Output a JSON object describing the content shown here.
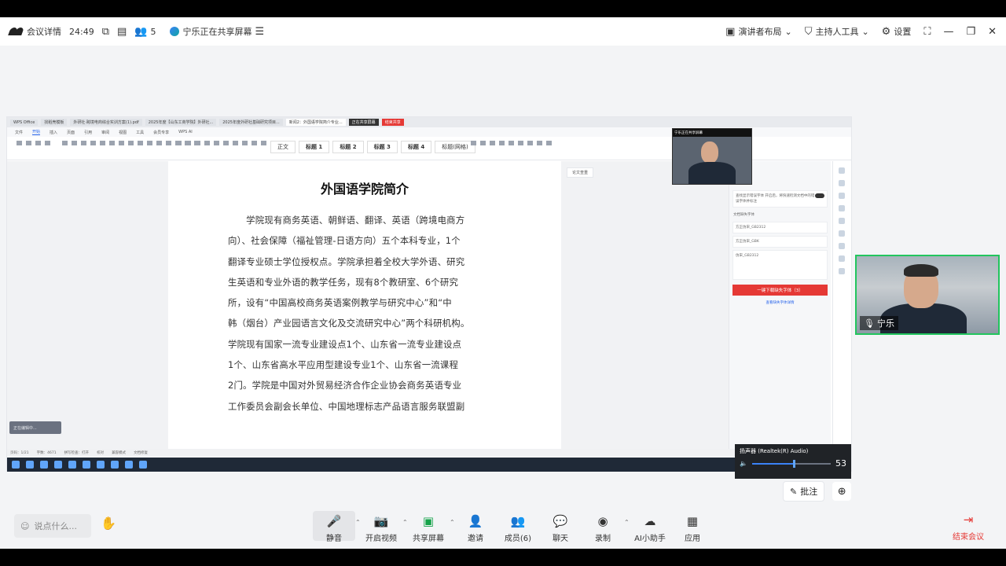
{
  "topbar": {
    "meeting_details": "会议详情",
    "timer": "24:49",
    "participants_count": "5",
    "sharing_text": "宁乐正在共享屏幕",
    "speaker_layout": "演讲者布局",
    "host_tools": "主持人工具",
    "settings": "设置"
  },
  "shared_screen": {
    "tabs": [
      "WPS Office",
      "找稻壳模板",
      "外研社·跨境电商综合实训方案(1).pdf",
      "2025年度【山东工商学院】外研社...",
      "2025年度外研社基础研究项目...",
      "新闻2：外国语学院简介专业...",
      "正在共享屏幕",
      "结束共享"
    ],
    "menu": [
      "文件",
      "开始",
      "插入",
      "页面",
      "引用",
      "审阅",
      "视图",
      "工具",
      "会员专享",
      "WPS AI"
    ],
    "styles": [
      "正文",
      "标题 1",
      "标题 2",
      "标题 3",
      "标题 4",
      "标题(网格)"
    ],
    "doc_title": "外国语学院简介",
    "doc_lines": [
      "　　学院现有商务英语、朝鲜语、翻译、英语（跨境电商方",
      "向）、社会保障（福祉管理-日语方向）五个本科专业，1个",
      "翻译专业硕士学位授权点。学院承担着全校大学外语、研究",
      "生英语和专业外语的教学任务，现有8个教研室、6个研究",
      "所，设有“中国高校商务英语案例教学与研究中心”和“中",
      "韩（烟台）产业园语言文化及交流研究中心”两个科研机构。",
      "学院现有国家一流专业建设点1个、山东省一流专业建设点",
      "1个、山东省高水平应用型建设专业1个、山东省一流课程",
      "2门。学院是中国对外贸易经济合作企业协会商务英语专业",
      "工作委员会副会长单位、中国地理标志产品语言服务联盟副"
    ],
    "doc_badge": "论文查重",
    "side_panel": {
      "card1": "查找显示错误字体 开启后，将快速检测文档中的错误字体并标注",
      "card_label": "文档缺失字体",
      "fonts": [
        "方正仿宋_GB2312",
        "方正仿宋_GBK",
        "仿宋_GB2312"
      ],
      "red_button": "一键下载缺失字体（3）",
      "link": "查看缺失字体详情"
    },
    "statusbar": [
      "页码：1/21",
      "字数：4671",
      "拼写检查：打开",
      "校对",
      "兼容模式",
      "文档修复"
    ],
    "toast": "正在编辑中...",
    "mini_video_header": "宁乐正在共享屏幕",
    "volume": {
      "device": "扬声器 (Realtek(R) Audio)",
      "value": "53",
      "fraction": 0.53
    }
  },
  "participant": {
    "name": "宁乐"
  },
  "annotate": {
    "label": "批注"
  },
  "bottombar": {
    "chat_placeholder": "说点什么...",
    "controls": [
      {
        "id": "mute",
        "label": "静音"
      },
      {
        "id": "video",
        "label": "开启视频"
      },
      {
        "id": "share",
        "label": "共享屏幕"
      },
      {
        "id": "invite",
        "label": "邀请"
      },
      {
        "id": "members",
        "label": "成员(6)"
      },
      {
        "id": "chat",
        "label": "聊天"
      },
      {
        "id": "record",
        "label": "录制"
      },
      {
        "id": "ai",
        "label": "AI小助手"
      },
      {
        "id": "apps",
        "label": "应用"
      }
    ],
    "end_meeting": "结束会议"
  }
}
